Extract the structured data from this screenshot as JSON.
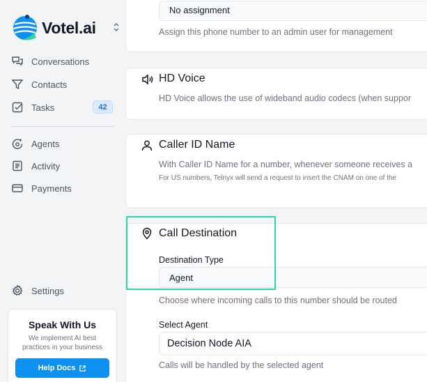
{
  "app": {
    "name": "Votel.ai",
    "brand_color": "#0e90f0"
  },
  "sidebar": {
    "items": [
      {
        "label": "Conversations",
        "icon": "chat-bubbles-icon"
      },
      {
        "label": "Contacts",
        "icon": "funnel-icon"
      },
      {
        "label": "Tasks",
        "icon": "checkbox-icon",
        "badge": "42"
      },
      {
        "label": "Agents",
        "icon": "sparkle-agent-icon"
      },
      {
        "label": "Activity",
        "icon": "document-list-icon"
      },
      {
        "label": "Payments",
        "icon": "credit-card-icon"
      }
    ],
    "settings_label": "Settings",
    "promo": {
      "title": "Speak With Us",
      "text": "We implement AI best practices in your business",
      "button_label": "Help Docs"
    }
  },
  "main": {
    "assignment": {
      "value": "No assignment",
      "description": "Assign this phone number to an admin user for management"
    },
    "hd_voice": {
      "title": "HD Voice",
      "description": "HD Voice allows the use of wideband audio codecs (when suppor"
    },
    "caller_id": {
      "title": "Caller ID Name",
      "description": "With Caller ID Name for a number, whenever someone receives a",
      "note": "For US numbers, Telnyx will send a request to insert the CNAM on one of the"
    },
    "call_destination": {
      "title": "Call Destination",
      "destination_type_label": "Destination Type",
      "destination_type_value": "Agent",
      "destination_type_hint": "Choose where incoming calls to this number should be routed",
      "select_agent_label": "Select Agent",
      "select_agent_value": "Decision Node AIA",
      "select_agent_hint": "Calls will be handled by the selected agent"
    },
    "highlight_color": "#2fd4a6"
  }
}
